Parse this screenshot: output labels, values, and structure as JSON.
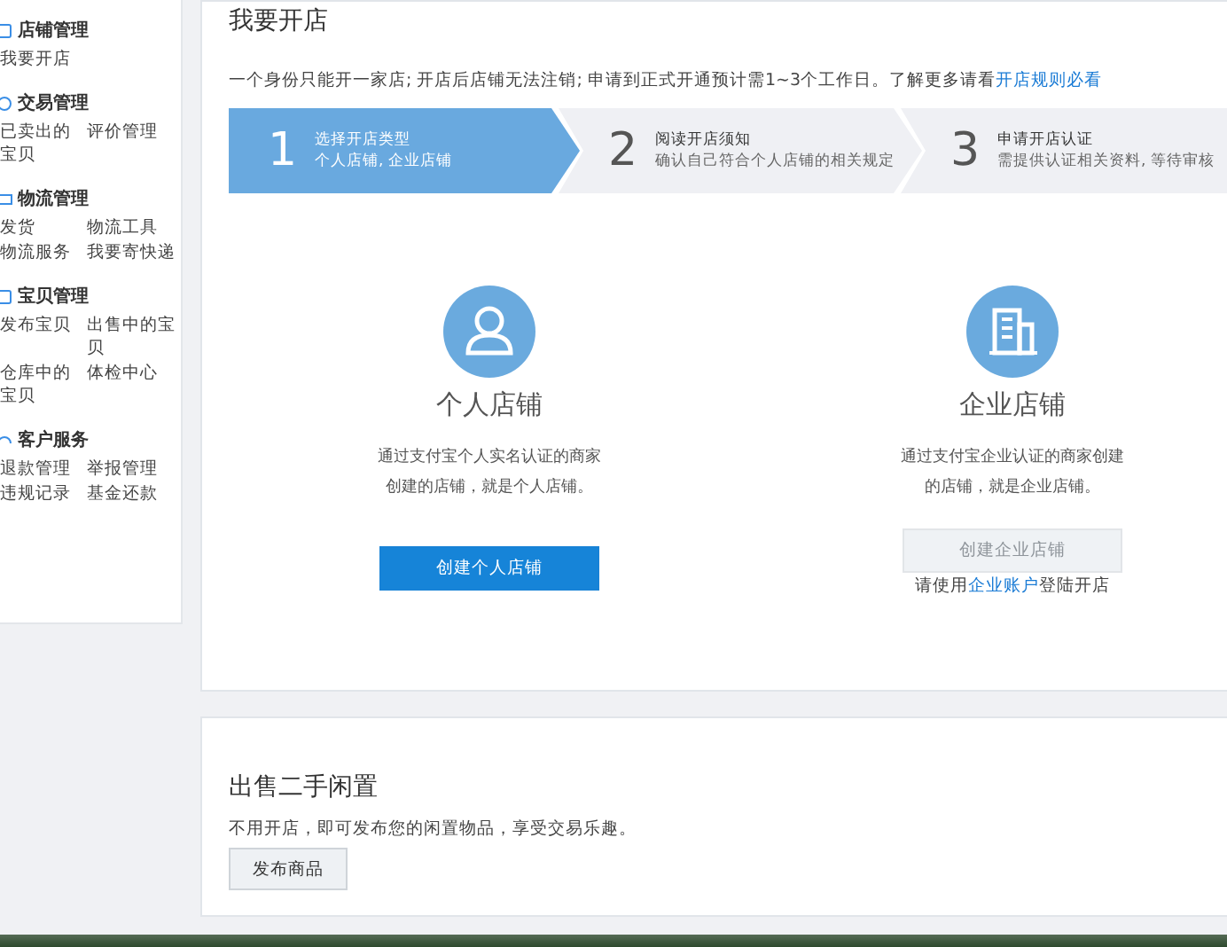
{
  "sidebar": {
    "groups": [
      {
        "title": "店铺管理",
        "items": [
          "我要开店"
        ]
      },
      {
        "title": "交易管理",
        "items": [
          "已卖出的宝贝",
          "评价管理"
        ]
      },
      {
        "title": "物流管理",
        "items": [
          "发货",
          "物流工具",
          "物流服务",
          "我要寄快递"
        ]
      },
      {
        "title": "宝贝管理",
        "items": [
          "发布宝贝",
          "出售中的宝贝",
          "仓库中的宝贝",
          "体检中心"
        ]
      },
      {
        "title": "客户服务",
        "items": [
          "退款管理",
          "举报管理",
          "违规记录",
          "基金还款"
        ]
      }
    ]
  },
  "open_shop": {
    "title": "我要开店",
    "notice": "一个身份只能开一家店; 开店后店铺无法注销; 申请到正式开通预计需1~3个工作日。了解更多请看",
    "notice_link": "开店规则必看",
    "steps": [
      {
        "number": "1",
        "title": "选择开店类型",
        "subtitle": "个人店铺, 企业店铺",
        "selected": true
      },
      {
        "number": "2",
        "title": "阅读开店须知",
        "subtitle": "确认自己符合个人店铺的相关规定",
        "selected": false
      },
      {
        "number": "3",
        "title": "申请开店认证",
        "subtitle": "需提供认证相关资料, 等待审核",
        "selected": false
      }
    ],
    "options": [
      {
        "kind": "person",
        "title": "个人店铺",
        "description": "通过支付宝个人实名认证的商家创建的店铺，就是个人店铺。",
        "button": "创建个人店铺",
        "disabled": false
      },
      {
        "kind": "company",
        "title": "企业店铺",
        "description": "通过支付宝企业认证的商家创建的店铺，就是企业店铺。",
        "button": "创建企业店铺",
        "disabled": true,
        "hint_before": "请使用",
        "hint_link": "企业账户",
        "hint_after": "登陆开店"
      }
    ]
  },
  "second_hand": {
    "title": "出售二手闲置",
    "description": "不用开店，即可发布您的闲置物品，享受交易乐趣。",
    "button": "发布商品"
  }
}
